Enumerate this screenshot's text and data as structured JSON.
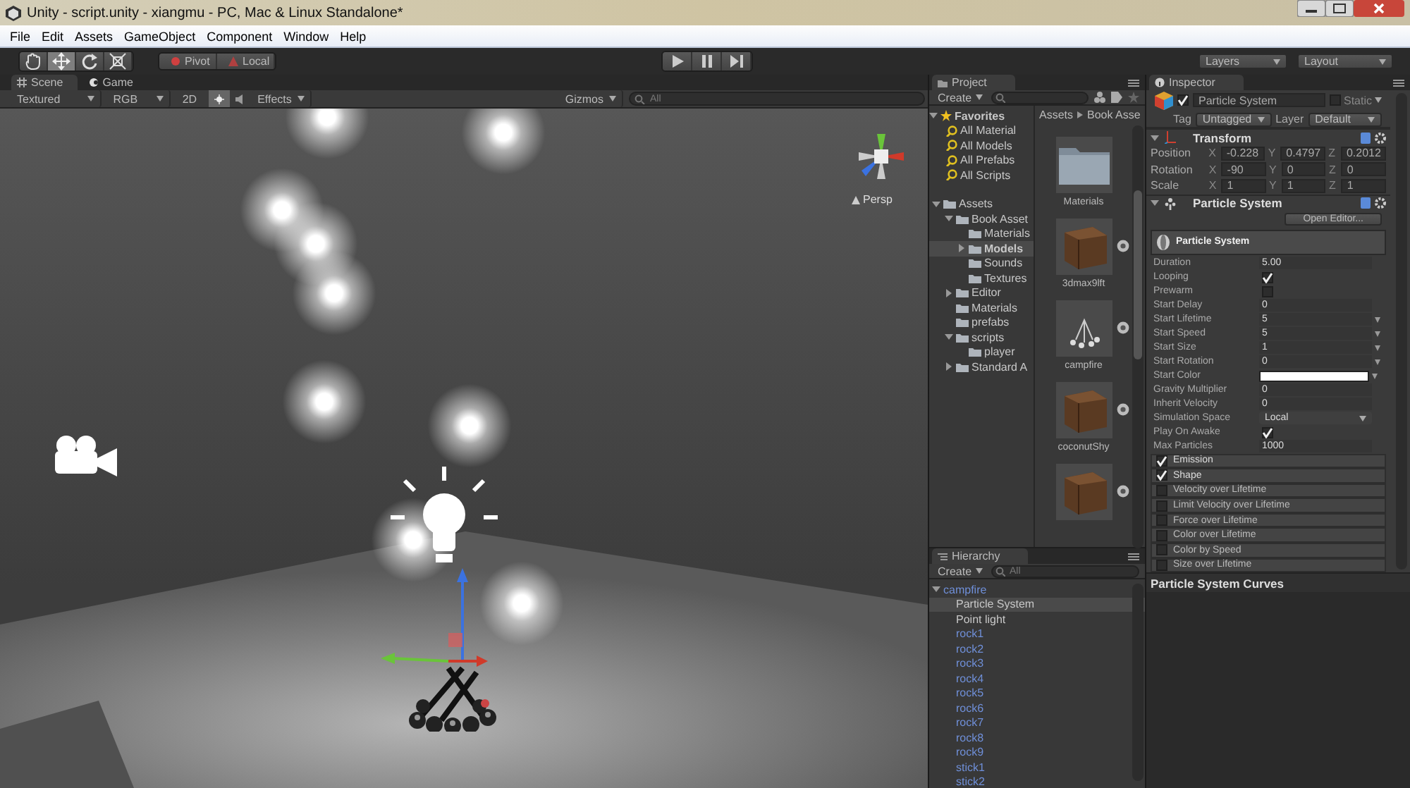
{
  "window": {
    "title": "Unity - script.unity - xiangmu - PC, Mac & Linux Standalone*"
  },
  "menu": [
    "File",
    "Edit",
    "Assets",
    "GameObject",
    "Component",
    "Window",
    "Help"
  ],
  "toolbar": {
    "tools": [
      {
        "kind": "hand",
        "selected": false
      },
      {
        "kind": "move",
        "selected": true
      },
      {
        "kind": "rotate",
        "selected": false
      },
      {
        "kind": "scale",
        "selected": false
      }
    ],
    "pivot": "Pivot",
    "local": "Local",
    "layers": "Layers",
    "layout": "Layout"
  },
  "scene": {
    "tabs": [
      {
        "label": "Scene",
        "selected": true
      },
      {
        "label": "Game",
        "selected": false
      }
    ],
    "render_mode": "Textured",
    "channel": "RGB",
    "mode_2d": "2D",
    "lighting_on": true,
    "effects": "Effects",
    "gizmos": "Gizmos",
    "search_placeholder": "All",
    "projection": "Persp"
  },
  "project": {
    "tab": "Project",
    "create": "Create",
    "favorites": {
      "label": "Favorites",
      "expanded": true,
      "items": [
        "All Material",
        "All Models",
        "All Prefabs",
        "All Scripts"
      ]
    },
    "tree": [
      {
        "label": "Assets",
        "expanded": true,
        "selected": false,
        "children": [
          {
            "label": "Book Asset",
            "expanded": true,
            "selected": false,
            "children": [
              {
                "label": "Materials",
                "selected": false
              },
              {
                "label": "Models",
                "expanded": false,
                "selected": true
              },
              {
                "label": "Sounds",
                "selected": false
              },
              {
                "label": "Textures",
                "selected": false
              }
            ]
          },
          {
            "label": "Editor",
            "expanded": false,
            "selected": false
          },
          {
            "label": "Materials",
            "selected": false
          },
          {
            "label": "prefabs",
            "selected": false
          },
          {
            "label": "scripts",
            "expanded": true,
            "selected": false,
            "children": [
              {
                "label": "player",
                "selected": false
              }
            ]
          },
          {
            "label": "Standard A",
            "expanded": false,
            "selected": false
          }
        ]
      }
    ],
    "breadcrumb": [
      "Assets",
      "Book Asse"
    ],
    "assets": [
      {
        "label": "Materials",
        "kind": "folder"
      },
      {
        "label": "3dmax9lft",
        "kind": "crate"
      },
      {
        "label": "campfire",
        "kind": "campfire"
      },
      {
        "label": "coconutShy",
        "kind": "crate"
      },
      {
        "kind": "crate"
      }
    ]
  },
  "hierarchy": {
    "tab": "Hierarchy",
    "create": "Create",
    "search_placeholder": "All",
    "tree": [
      {
        "label": "campfire",
        "kind": "prefab",
        "expanded": true,
        "selected": false,
        "children": [
          {
            "label": "Particle System",
            "kind": "object",
            "selected": true
          },
          {
            "label": "Point light",
            "kind": "object",
            "selected": false
          },
          {
            "label": "rock1",
            "kind": "prefab",
            "selected": false
          },
          {
            "label": "rock2",
            "kind": "prefab",
            "selected": false
          },
          {
            "label": "rock3",
            "kind": "prefab",
            "selected": false
          },
          {
            "label": "rock4",
            "kind": "prefab",
            "selected": false
          },
          {
            "label": "rock5",
            "kind": "prefab",
            "selected": false
          },
          {
            "label": "rock6",
            "kind": "prefab",
            "selected": false
          },
          {
            "label": "rock7",
            "kind": "prefab",
            "selected": false
          },
          {
            "label": "rock8",
            "kind": "prefab",
            "selected": false
          },
          {
            "label": "rock9",
            "kind": "prefab",
            "selected": false
          },
          {
            "label": "stick1",
            "kind": "prefab",
            "selected": false
          },
          {
            "label": "stick2",
            "kind": "prefab",
            "selected": false
          }
        ]
      }
    ]
  },
  "inspector": {
    "tab": "Inspector",
    "active": true,
    "name": "Particle System",
    "static": {
      "label": "Static",
      "checked": false
    },
    "tag_label": "Tag",
    "tag": "Untagged",
    "layer_label": "Layer",
    "layer": "Default",
    "transform": {
      "title": "Transform",
      "expanded": true,
      "rows": [
        {
          "label": "Position",
          "values": [
            {
              "axis": "X",
              "value": "-0.228"
            },
            {
              "axis": "Y",
              "value": "0.4797"
            },
            {
              "axis": "Z",
              "value": "0.2012"
            }
          ]
        },
        {
          "label": "Rotation",
          "values": [
            {
              "axis": "X",
              "value": "-90"
            },
            {
              "axis": "Y",
              "value": "0"
            },
            {
              "axis": "Z",
              "value": "0"
            }
          ]
        },
        {
          "label": "Scale",
          "values": [
            {
              "axis": "X",
              "value": "1"
            },
            {
              "axis": "Y",
              "value": "1"
            },
            {
              "axis": "Z",
              "value": "1"
            }
          ]
        }
      ]
    },
    "particle_system": {
      "title": "Particle System",
      "expanded": true,
      "open_editor": "Open Editor...",
      "module_title": "Particle System",
      "properties": [
        {
          "label": "Duration",
          "kind": "text",
          "value": "5.00"
        },
        {
          "label": "Looping",
          "kind": "checkbox",
          "checked": true
        },
        {
          "label": "Prewarm",
          "kind": "checkbox",
          "checked": false
        },
        {
          "label": "Start Delay",
          "kind": "text",
          "value": "0"
        },
        {
          "label": "Start Lifetime",
          "kind": "curve",
          "value": "5"
        },
        {
          "label": "Start Speed",
          "kind": "curve",
          "value": "5"
        },
        {
          "label": "Start Size",
          "kind": "curve",
          "value": "1"
        },
        {
          "label": "Start Rotation",
          "kind": "curve",
          "value": "0"
        },
        {
          "label": "Start Color",
          "kind": "color",
          "color": "#ffffff"
        },
        {
          "label": "Gravity Multiplier",
          "kind": "text",
          "value": "0"
        },
        {
          "label": "Inherit Velocity",
          "kind": "text",
          "value": "0"
        },
        {
          "label": "Simulation Space",
          "kind": "dropdown",
          "value": "Local"
        },
        {
          "label": "Play On Awake",
          "kind": "checkbox",
          "checked": true
        },
        {
          "label": "Max Particles",
          "kind": "text",
          "value": "1000"
        }
      ],
      "modules": [
        {
          "label": "Emission",
          "checked": true
        },
        {
          "label": "Shape",
          "checked": true
        },
        {
          "label": "Velocity over Lifetime",
          "checked": false
        },
        {
          "label": "Limit Velocity over Lifetime",
          "checked": false
        },
        {
          "label": "Force over Lifetime",
          "checked": false
        },
        {
          "label": "Color over Lifetime",
          "checked": false
        },
        {
          "label": "Color by Speed",
          "checked": false
        },
        {
          "label": "Size over Lifetime",
          "checked": false
        }
      ]
    },
    "curves_title": "Particle System Curves"
  }
}
